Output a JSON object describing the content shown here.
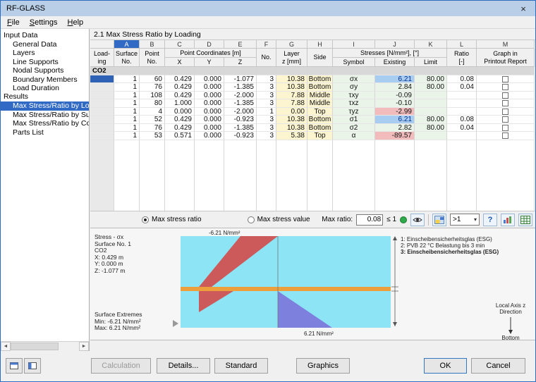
{
  "window": {
    "title": "RF-GLASS"
  },
  "icons": {
    "close": "×",
    "scroll_left": "◄",
    "scroll_right": "►",
    "caret": "▾",
    "help": "?"
  },
  "menu": {
    "items": [
      "File",
      "Settings",
      "Help"
    ]
  },
  "navigator": {
    "sections": [
      {
        "label": "Input Data",
        "items": [
          "General Data",
          "Layers",
          "Line Supports",
          "Nodal Supports",
          "Boundary Members",
          "Load Duration"
        ],
        "selected_item": ""
      },
      {
        "label": "Results",
        "items": [
          "Max Stress/Ratio by Loading",
          "Max Stress/Ratio by Surface",
          "Max Stress/Ratio by Composition",
          "Parts List"
        ],
        "selected_item": "Max Stress/Ratio by Loading"
      }
    ]
  },
  "panel": {
    "title": "2.1 Max Stress Ratio by Loading"
  },
  "table": {
    "column_letters": [
      "A",
      "B",
      "C",
      "D",
      "E",
      "F",
      "G",
      "H",
      "I",
      "J",
      "K",
      "L",
      "M"
    ],
    "headers": {
      "loading": "Load-\ning",
      "surface": "Surface\nNo.",
      "point": "Point\nNo.",
      "coords_group": "Point Coordinates [m]",
      "coords": [
        "X",
        "Y",
        "Z"
      ],
      "no": "No.",
      "layer": "Layer\nz [mm]",
      "side": "Side",
      "stresses_group": "Stresses [N/mm²], [°]",
      "stresses": [
        "Symbol",
        "Existing",
        "Limit"
      ],
      "ratio": "Ratio\n[-]",
      "graph": "Graph in\nPrintout Report"
    },
    "group_row": {
      "loading": "CO2"
    },
    "rows": [
      {
        "surface": "1",
        "point": "60",
        "x": "0.429",
        "y": "0.000",
        "z": "-1.077",
        "no": "3",
        "layer_z": "10.38",
        "side": "Bottom",
        "symbol": "σx",
        "existing": "6.21",
        "limit": "80.00",
        "ratio": "0.08",
        "hl": "blue",
        "sel": true
      },
      {
        "surface": "1",
        "point": "76",
        "x": "0.429",
        "y": "0.000",
        "z": "-1.385",
        "no": "3",
        "layer_z": "10.38",
        "side": "Bottom",
        "symbol": "σy",
        "existing": "2.84",
        "limit": "80.00",
        "ratio": "0.04",
        "hl": ""
      },
      {
        "surface": "1",
        "point": "108",
        "x": "0.429",
        "y": "0.000",
        "z": "-2.000",
        "no": "3",
        "layer_z": "7.88",
        "side": "Middle",
        "symbol": "τxy",
        "existing": "-0.09",
        "limit": "",
        "ratio": "",
        "hl": ""
      },
      {
        "surface": "1",
        "point": "80",
        "x": "1.000",
        "y": "0.000",
        "z": "-1.385",
        "no": "3",
        "layer_z": "7.88",
        "side": "Middle",
        "symbol": "τxz",
        "existing": "-0.10",
        "limit": "",
        "ratio": "",
        "hl": ""
      },
      {
        "surface": "1",
        "point": "4",
        "x": "0.000",
        "y": "0.000",
        "z": "-2.000",
        "no": "1",
        "layer_z": "0.00",
        "side": "Top",
        "symbol": "τyz",
        "existing": "-2.99",
        "limit": "",
        "ratio": "",
        "hl": "pink"
      },
      {
        "surface": "1",
        "point": "52",
        "x": "0.429",
        "y": "0.000",
        "z": "-0.923",
        "no": "3",
        "layer_z": "10.38",
        "side": "Bottom",
        "symbol": "σ1",
        "existing": "6.21",
        "limit": "80.00",
        "ratio": "0.08",
        "hl": "blue"
      },
      {
        "surface": "1",
        "point": "76",
        "x": "0.429",
        "y": "0.000",
        "z": "-1.385",
        "no": "3",
        "layer_z": "10.38",
        "side": "Bottom",
        "symbol": "σ2",
        "existing": "2.82",
        "limit": "80.00",
        "ratio": "0.04",
        "hl": ""
      },
      {
        "surface": "1",
        "point": "53",
        "x": "0.571",
        "y": "0.000",
        "z": "-0.923",
        "no": "3",
        "layer_z": "5.38",
        "side": "Top",
        "symbol": "α",
        "existing": "-89.57",
        "limit": "",
        "ratio": "",
        "hl": "pink"
      }
    ]
  },
  "filter_bar": {
    "radio_ratio": "Max stress ratio",
    "radio_value": "Max stress value",
    "max_ratio_label": "Max ratio:",
    "max_ratio_value": "0.08",
    "max_ratio_limit": "≤ 1",
    "dropdown_value": ">1"
  },
  "graphic": {
    "info": [
      "Stress - σx",
      "Surface No. 1",
      "CO2",
      "X:  0.429 m",
      "Y:  0.000 m",
      "Z: -1.077 m"
    ],
    "extremes": [
      "Surface Extremes",
      "Min: -6.21 N/mm²",
      "Max:  6.21 N/mm²"
    ],
    "top_label": "-6.21 N/mm²",
    "bottom_label": "6.21 N/mm²",
    "legend": [
      "1: Einscheibensicherheitsglas (ESG)",
      "2: PVB 22 °C Belastung bis 3 min",
      "3: Einscheibensicherheitsglas (ESG)"
    ],
    "axis_line1": "Local Axis z",
    "axis_line2": "Direction",
    "axis_bottom": "Bottom"
  },
  "buttons": {
    "calculation": "Calculation",
    "details": "Details...",
    "standard": "Standard",
    "graphics": "Graphics",
    "ok": "OK",
    "cancel": "Cancel"
  },
  "colors": {
    "selection": "#316ac5",
    "existing_max_highlight": "#a8cdf0",
    "existing_min_highlight": "#f3bcbc",
    "glass_section": "#8ce4f4",
    "interlayer": "#ed9f3c",
    "stress_negative": "#cd5a5a",
    "stress_positive": "#7d80dd",
    "status_ok": "#2faa4a"
  }
}
